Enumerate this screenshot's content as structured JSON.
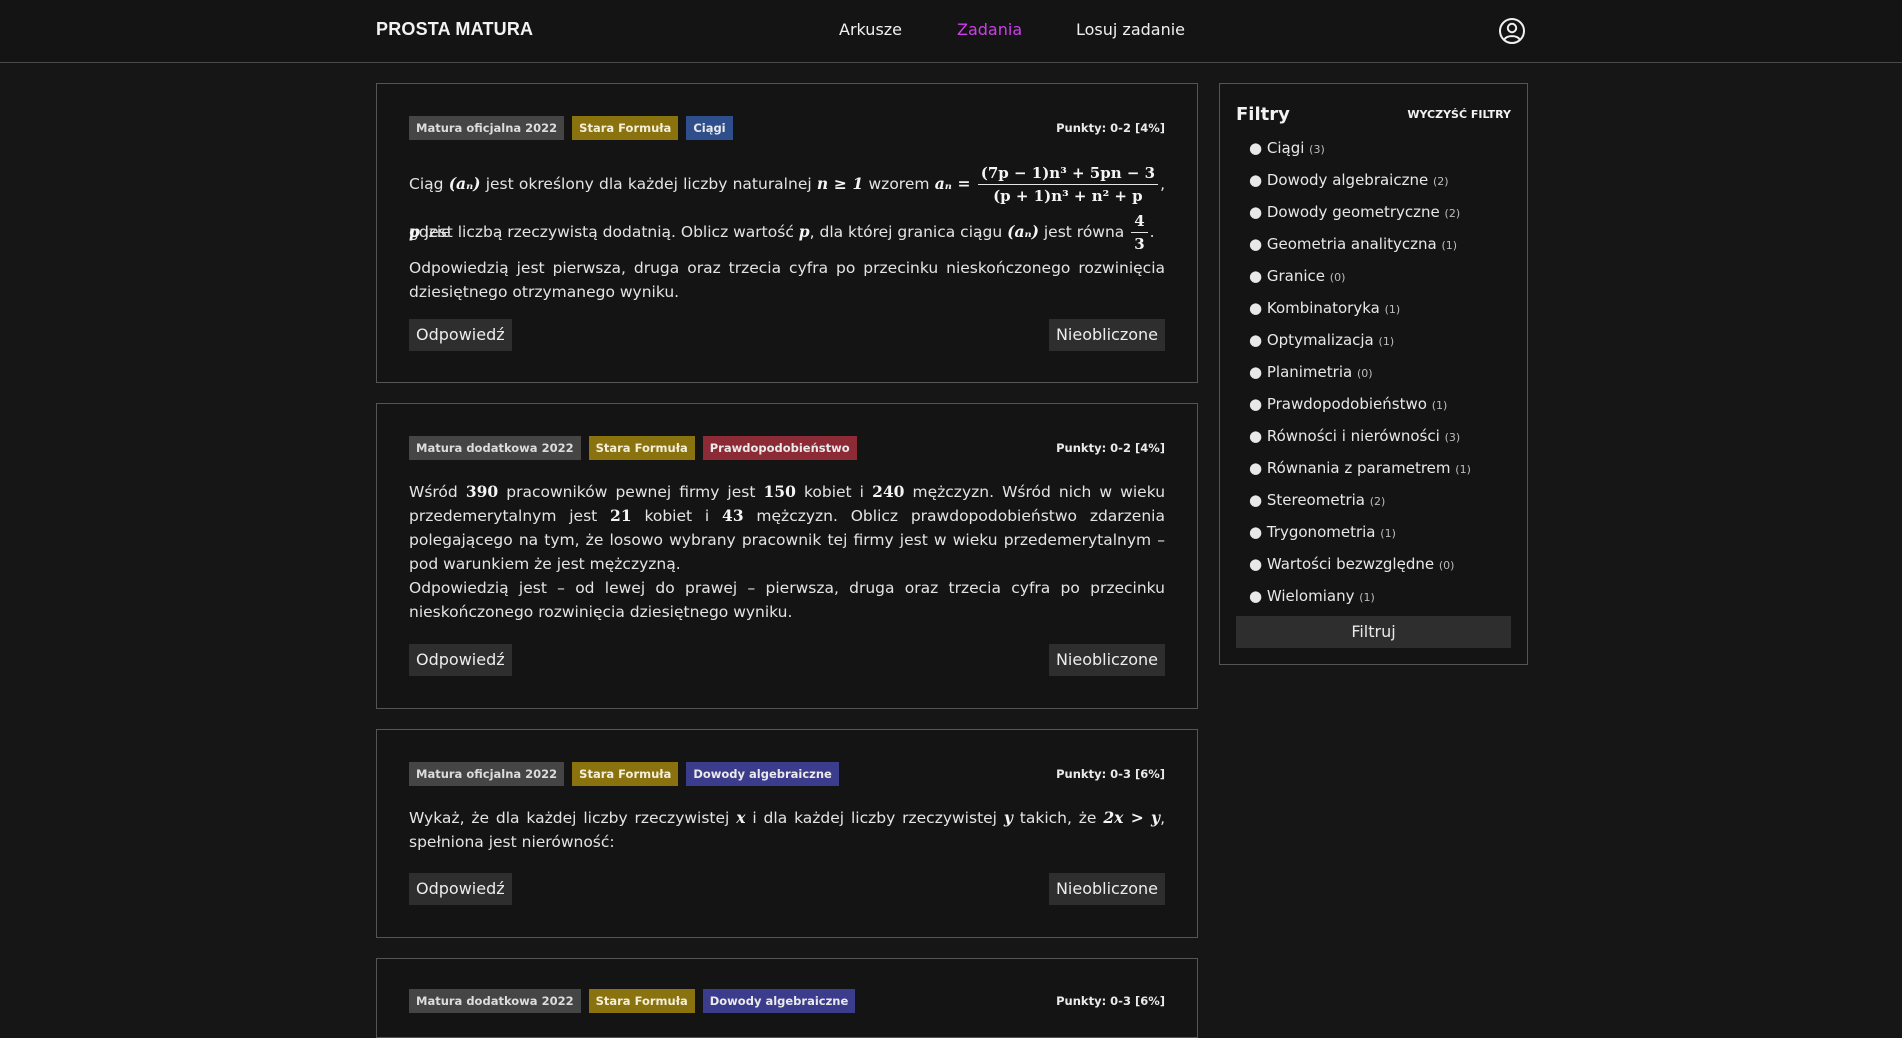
{
  "header": {
    "brand": "PROSTA MATURA",
    "nav": [
      {
        "label": "Arkusze"
      },
      {
        "label": "Zadania",
        "active": true
      },
      {
        "label": "Losuj zadanie"
      }
    ],
    "user_icon": "user-circle-icon"
  },
  "tasks": [
    {
      "tags": [
        "Matura oficjalna 2022",
        "Stara Formuła",
        "Ciągi"
      ],
      "tag_colors": [
        "#454545",
        "#8a720f",
        "#2f4f8c"
      ],
      "points": "Punkty: 0-2 [4%]",
      "text": {
        "p1a": "Ciąg",
        "m_an": "(aₙ)",
        "p1b": "jest określony dla każdej liczby naturalnej",
        "m_n1": "n ≥ 1",
        "p1c": "wzorem",
        "m_an2": "aₙ =",
        "frac_num": "(7p − 1)n³ + 5pn − 3",
        "frac_den": "(p + 1)n³ + n² + p",
        "p1d": ", gdzie",
        "m_p": "p",
        "p2a": "jest liczbą rzeczywistą dodatnią. Oblicz wartość",
        "m_p2": "p",
        "p2b": ", dla której granica ciągu",
        "m_an3": "(aₙ)",
        "p2c": "jest równa",
        "frac2_num": "4",
        "frac2_den": "3",
        "p2d": ".",
        "p3": "Odpowiedzią jest pierwsza, druga oraz trzecia cyfra po przecinku nieskończonego rozwinięcia dziesiętnego otrzymanego wyniku."
      },
      "answer_label": "Odpowiedź",
      "status_label": "Nieobliczone"
    },
    {
      "tags": [
        "Matura dodatkowa 2022",
        "Stara Formuła",
        "Prawdopodobieństwo"
      ],
      "tag_colors": [
        "#454545",
        "#8a720f",
        "#8c2a36"
      ],
      "points": "Punkty: 0-2 [4%]",
      "text": {
        "a": "Wśród",
        "n390": "390",
        "b": "pracowników pewnej firmy jest",
        "n150": "150",
        "c": "kobiet i",
        "n240": "240",
        "d": "mężczyzn. Wśród nich w wieku przedemerytalnym jest",
        "n21": "21",
        "e": "kobiet i",
        "n43": "43",
        "f": "mężczyzn. Oblicz prawdopodobieństwo zdarzenia polegającego na tym, że losowo wybrany pracownik tej firmy jest w wieku przedemerytalnym – pod warunkiem że jest mężczyzną.",
        "g": "Odpowiedzią jest – od lewej do prawej – pierwsza, druga oraz trzecia cyfra po przecinku nieskończonego rozwinięcia dziesiętnego wyniku."
      },
      "answer_label": "Odpowiedź",
      "status_label": "Nieobliczone"
    },
    {
      "tags": [
        "Matura oficjalna 2022",
        "Stara Formuła",
        "Dowody algebraiczne"
      ],
      "tag_colors": [
        "#454545",
        "#8a720f",
        "#3c3c8c"
      ],
      "points": "Punkty: 0-3 [6%]",
      "text": {
        "a": "Wykaż, że dla każdej liczby rzeczywistej",
        "x": "x",
        "b": "i dla każdej liczby rzeczywistej",
        "y": "y",
        "c": "takich, że",
        "ineq": "2x > y",
        "d": ", spełniona jest nierówność:"
      },
      "answer_label": "Odpowiedź",
      "status_label": "Nieobliczone"
    },
    {
      "tags": [
        "Matura dodatkowa 2022",
        "Stara Formuła",
        "Dowody algebraiczne"
      ],
      "tag_colors": [
        "#454545",
        "#8a720f",
        "#3c3c8c"
      ],
      "points": "Punkty: 0-3 [6%]"
    }
  ],
  "filters": {
    "title": "Filtry",
    "clear_label": "WYCZYŚĆ FILTRY",
    "items": [
      {
        "label": "● Ciągi",
        "count": "(3)"
      },
      {
        "label": "● Dowody algebraiczne",
        "count": "(2)"
      },
      {
        "label": "● Dowody geometryczne",
        "count": "(2)"
      },
      {
        "label": "● Geometria analityczna",
        "count": "(1)"
      },
      {
        "label": "● Granice",
        "count": "(0)"
      },
      {
        "label": "● Kombinatoryka",
        "count": "(1)"
      },
      {
        "label": "● Optymalizacja",
        "count": "(1)"
      },
      {
        "label": "● Planimetria",
        "count": "(0)"
      },
      {
        "label": "● Prawdopodobieństwo",
        "count": "(1)"
      },
      {
        "label": "● Równości i nierówności",
        "count": "(3)"
      },
      {
        "label": "● Równania z parametrem",
        "count": "(1)"
      },
      {
        "label": "● Stereometria",
        "count": "(2)"
      },
      {
        "label": "● Trygonometria",
        "count": "(1)"
      },
      {
        "label": "● Wartości bezwzględne",
        "count": "(0)"
      },
      {
        "label": "● Wielomiany",
        "count": "(1)"
      }
    ],
    "button_label": "Filtruj"
  }
}
